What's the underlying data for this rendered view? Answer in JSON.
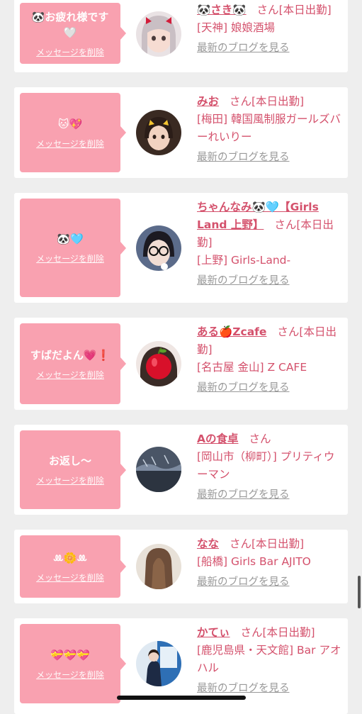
{
  "common": {
    "delete_label": "メッセージを削除",
    "blog_label": "最新のブログを見る",
    "san": "さん"
  },
  "items": [
    {
      "message": "🐼お疲れ様です🤍",
      "name": "🐼さき🐼",
      "status": "[本日出勤]",
      "location": "[天神] 娘娘酒場"
    },
    {
      "message": "🐱💖",
      "name": "みお",
      "status": "[本日出勤]",
      "location": "[梅田] 韓国風制服ガールズバーれいりー"
    },
    {
      "message": "🐼🩵",
      "name": "ちゃんなみ🐼🩵【Girls Land 上野】",
      "status": "[本日出勤]",
      "location": "[上野] Girls-Land-"
    },
    {
      "message": "すばだよん💗❗️",
      "name": "ある🍎Zcafe",
      "status": "[本日出勤]",
      "location": "[名古屋 金山] Z CAFE"
    },
    {
      "message": "お返し〜",
      "name": "Aの食卓",
      "status": "",
      "location": "[岡山市（柳町）] プリティウーマン"
    },
    {
      "message": "ꔛ🌼ꔛ",
      "name": "なな",
      "status": "[本日出勤]",
      "location": "[船橋] Girls Bar AJITO"
    },
    {
      "message": "💝💝💝",
      "name": "かてぃ",
      "status": "[本日出勤]",
      "location": "[鹿児島県・天文館] Bar アオハル"
    }
  ]
}
